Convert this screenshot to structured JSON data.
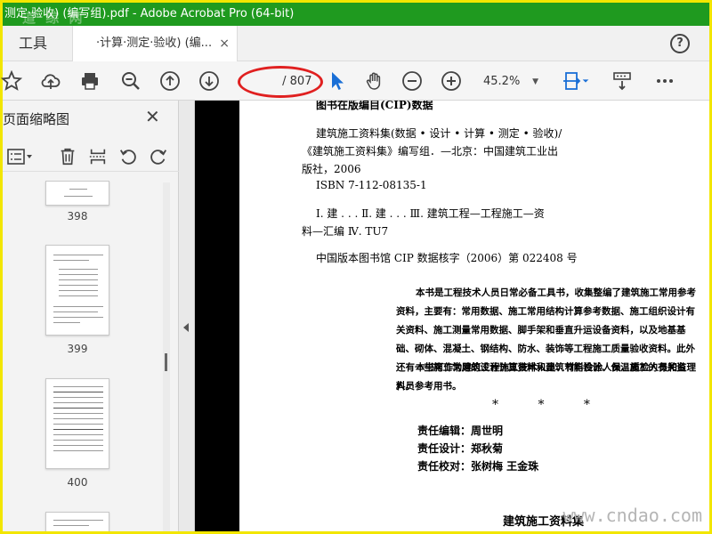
{
  "window": {
    "title": "测定·验收) (编写组).pdf - Adobe Acrobat Pro (64-bit)",
    "watermark": "道 综 网"
  },
  "tabs": {
    "tools_label": "工具",
    "doc_tab_label": "·计算·测定·验收) (编...",
    "close_glyph": "×",
    "help_glyph": "?"
  },
  "toolbar": {
    "current_page": "",
    "page_total": "/ 807",
    "zoom_value": "45.2%",
    "zoom_arrow": "▼"
  },
  "left_panel": {
    "title": "页面缩略图",
    "close_glyph": "✕",
    "thumbnails": [
      {
        "label": "398"
      },
      {
        "label": "399"
      },
      {
        "label": "400"
      }
    ]
  },
  "document": {
    "header_line": "图书在版编目(CIP)数据",
    "lines": [
      "建筑施工资料集(数据 • 设计 • 计算 • 测定 • 验收)/",
      "《建筑施工资料集》编写组．—北京：中国建筑工业出",
      "版社，2006",
      "ISBN 7-112-08135-1",
      "Ⅰ. 建 . . .    Ⅱ. 建 . . .    Ⅲ. 建筑工程—工程施工—资",
      "料—汇编   Ⅳ. TU7",
      "中国版本图书馆 CIP 数据核字（2006）第 022408 号"
    ],
    "paragraphs": [
      "本书是工程技术人员日常必备工具书，收集整编了建筑施工常用参考资料，主要有：常用数据、施工常用结构计算参考数据、施工组织设计有关资料、施工测量常用数据、脚手架和垂直升运设备资料，以及地基基础、砌体、混凝土、钢结构、防水、装饰等工程施工质量验收资料。此外还有一些施工常用的设计计算资料和建筑节能设计、保温施工的有关资料。",
      "本书可作为建筑工程施工技术人员、材料检验人员、质检人员和监理人员参考用书。"
    ],
    "stars": "* * *",
    "credits": [
      "责任编辑：周世明",
      "责任设计：郑秋菊",
      "责任校对：张树梅    王金珠"
    ],
    "footer_title": "建筑施工资料集",
    "site_watermark": "www.cndao.com"
  }
}
